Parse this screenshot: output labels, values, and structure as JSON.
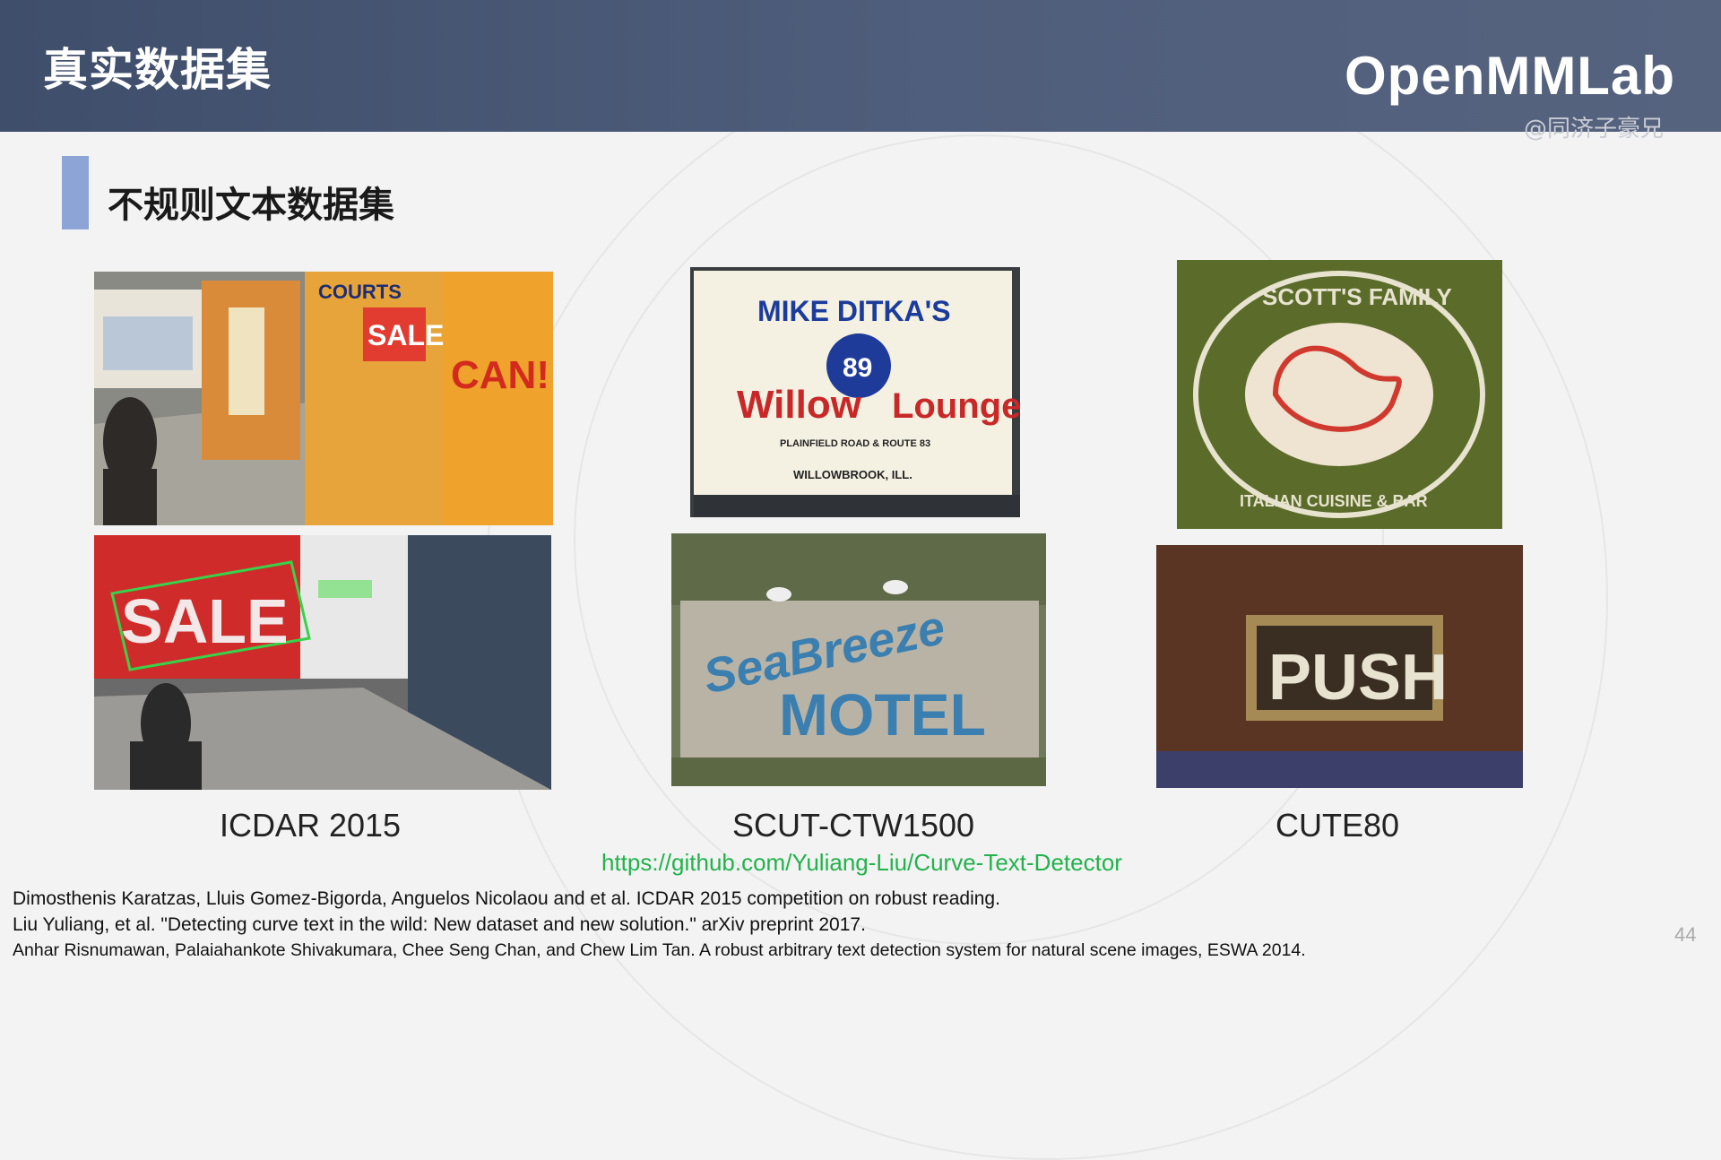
{
  "header": {
    "title": "真实数据集",
    "logo_text": "OpenMMLab",
    "watermark": "@同济子豪兄"
  },
  "section": {
    "title": "不规则文本数据集"
  },
  "photos": {
    "icdar_top": {
      "texts": [
        "COURTS",
        "SALE",
        "CAN!"
      ]
    },
    "icdar_bottom": {
      "texts": [
        "SALE"
      ]
    },
    "ctw_top": {
      "texts": [
        "MIKE DITKA'S",
        "89",
        "Willow",
        "Lounge",
        "PLAINFIELD ROAD & ROUTE 83",
        "WILLOWBROOK, ILL."
      ]
    },
    "ctw_bottom": {
      "texts": [
        "SeaBreeze",
        "MOTEL"
      ]
    },
    "cute_top": {
      "texts": [
        "SCOTT'S FAMILY",
        "ITALIAN CUISINE & BAR"
      ]
    },
    "cute_bottom": {
      "texts": [
        "PUSH"
      ]
    }
  },
  "captions": {
    "icdar": "ICDAR 2015",
    "ctw": "SCUT-CTW1500",
    "cute": "CUTE80"
  },
  "link": "https://github.com/Yuliang-Liu/Curve-Text-Detector",
  "references": [
    "Dimosthenis Karatzas, Lluis Gomez-Bigorda, Anguelos Nicolaou and et al. ICDAR 2015 competition on robust reading.",
    "Liu Yuliang, et al. \"Detecting curve text in the wild: New dataset and new solution.\" arXiv preprint 2017.",
    "Anhar Risnumawan, Palaiahankote Shivakumara, Chee Seng Chan, and Chew Lim Tan. A robust arbitrary text detection system for natural scene images, ESWA 2014."
  ],
  "page_number": "44",
  "colors": {
    "header_bg": "#46546f",
    "accent_bar": "#8da4d6",
    "link": "#22b24c"
  }
}
